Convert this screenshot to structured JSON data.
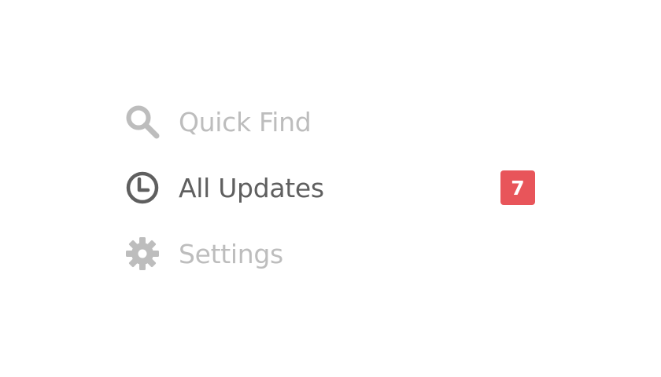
{
  "colors": {
    "inactive": "#bdbdbd",
    "active": "#5f5f5f",
    "badge_bg": "#e8555a",
    "badge_text": "#ffffff"
  },
  "menu": {
    "items": [
      {
        "label": "Quick Find",
        "icon": "search-icon",
        "state": "inactive"
      },
      {
        "label": "All Updates",
        "icon": "clock-icon",
        "state": "active",
        "badge": "7"
      },
      {
        "label": "Settings",
        "icon": "gear-icon",
        "state": "inactive"
      }
    ]
  }
}
